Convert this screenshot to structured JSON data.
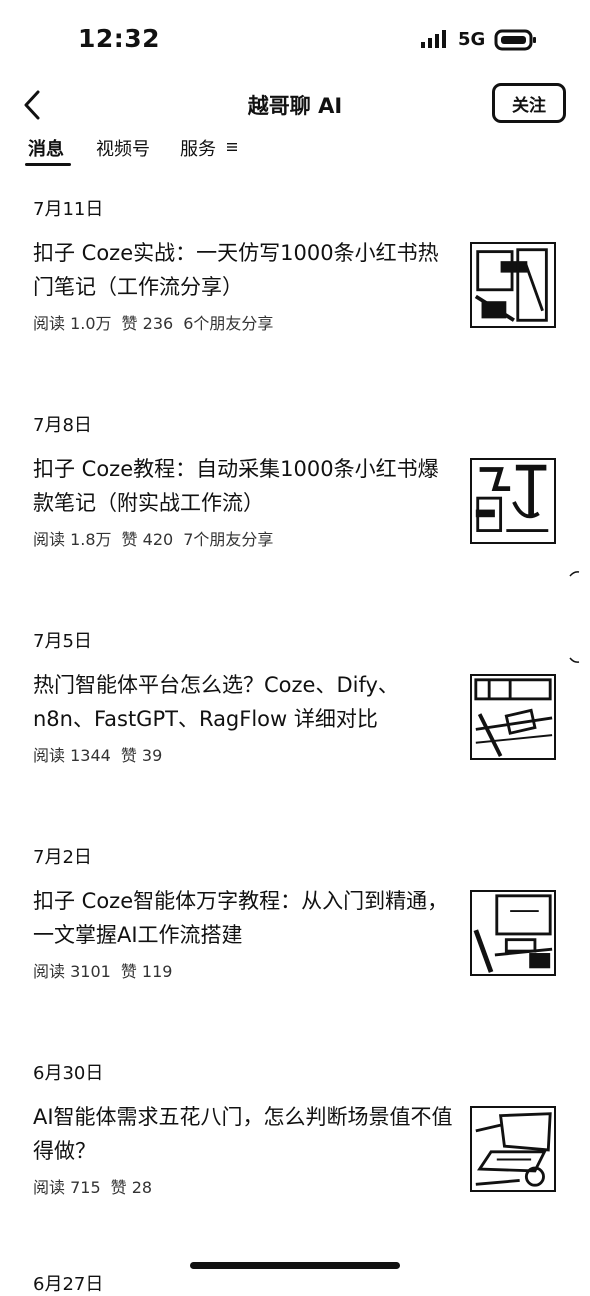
{
  "status_bar": {
    "time": "12:32",
    "network": "5G",
    "signal_icon": "signal-bars-icon",
    "battery_icon": "battery-icon"
  },
  "header": {
    "back_icon": "chevron-left-icon",
    "title": "越哥聊 AI",
    "follow_label": "关注"
  },
  "tabs": [
    {
      "label": "消息",
      "active": true
    },
    {
      "label": "视频号",
      "active": false
    },
    {
      "label": "服务",
      "active": false,
      "icon": "menu-lines-icon"
    }
  ],
  "feed": [
    {
      "date": "7月11日",
      "title": "扣子 Coze实战：一天仿写1000条小红书热门笔记（工作流分享）",
      "reads": "阅读 1.0万",
      "likes": "赞 236",
      "shares": "6个朋友分享",
      "thumbnail_icon": "article-thumbnail-icon"
    },
    {
      "date": "7月8日",
      "title": "扣子 Coze教程：自动采集1000条小红书爆款笔记（附实战工作流）",
      "reads": "阅读 1.8万",
      "likes": "赞 420",
      "shares": "7个朋友分享",
      "thumbnail_icon": "article-thumbnail-icon"
    },
    {
      "date": "7月5日",
      "title": "热门智能体平台怎么选？Coze、Dify、n8n、FastGPT、RagFlow 详细对比",
      "reads": "阅读 1344",
      "likes": "赞 39",
      "shares": "",
      "thumbnail_icon": "article-thumbnail-icon"
    },
    {
      "date": "7月2日",
      "title": "扣子 Coze智能体万字教程：从入门到精通，一文掌握AI工作流搭建",
      "reads": "阅读 3101",
      "likes": "赞 119",
      "shares": "",
      "thumbnail_icon": "article-thumbnail-icon"
    },
    {
      "date": "6月30日",
      "title": "AI智能体需求五花八门，怎么判断场景值不值得做？",
      "reads": "阅读 715",
      "likes": "赞 28",
      "shares": "",
      "thumbnail_icon": "article-thumbnail-icon"
    }
  ],
  "next_date_partial": "6月27日",
  "colors": {
    "text": "#111111",
    "secondary_text": "#333333",
    "background": "#ffffff"
  }
}
